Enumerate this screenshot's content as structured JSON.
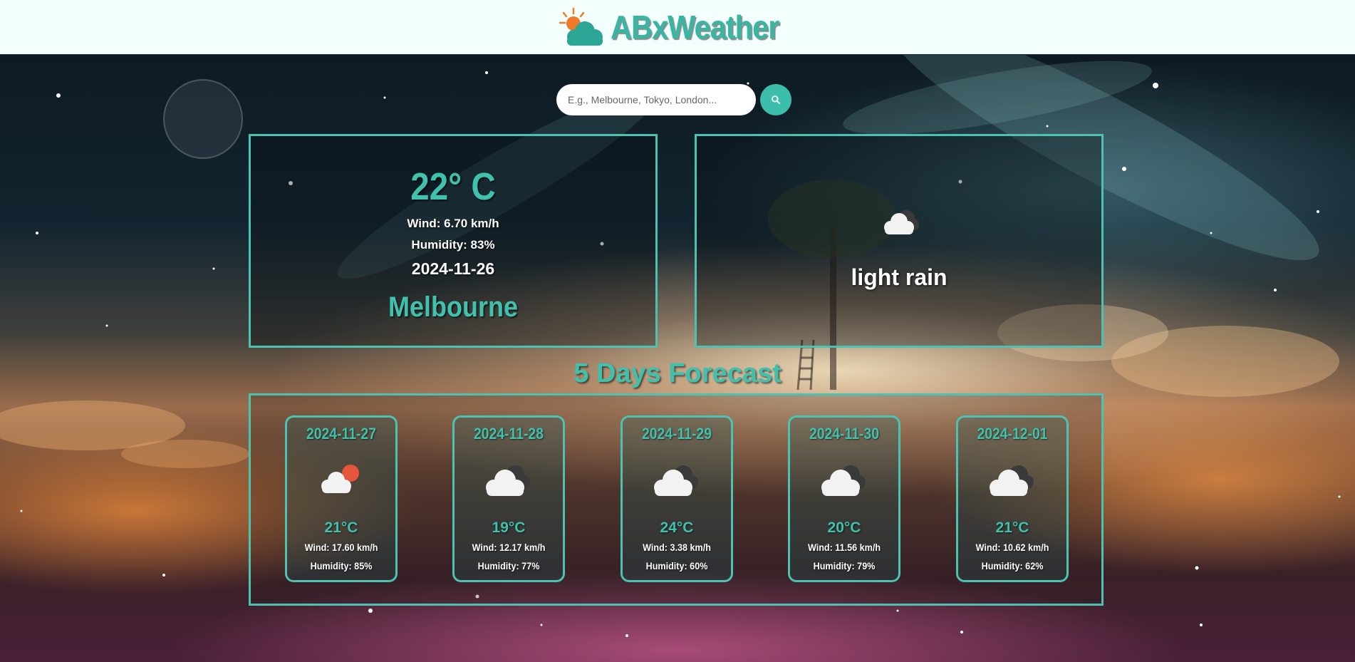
{
  "header": {
    "brand_name": "ABxWeather",
    "logo_icon": "sun-cloud-logo-icon"
  },
  "search": {
    "placeholder": "E.g., Melbourne, Tokyo, London...",
    "value": "",
    "button_icon": "search-icon"
  },
  "current": {
    "temperature": "22° C",
    "wind": "Wind: 6.70 km/h",
    "humidity": "Humidity: 83%",
    "date": "2024-11-26",
    "city": "Melbourne",
    "condition": "light rain",
    "condition_icon": "rain-cloud-icon"
  },
  "forecast": {
    "title": "5 Days Forecast",
    "days": [
      {
        "date": "2024-11-27",
        "temp": "21°C",
        "wind": "Wind: 17.60 km/h",
        "humidity": "Humidity: 85%",
        "icon": "partly-cloudy-icon"
      },
      {
        "date": "2024-11-28",
        "temp": "19°C",
        "wind": "Wind: 12.17 km/h",
        "humidity": "Humidity: 77%",
        "icon": "cloudy-icon"
      },
      {
        "date": "2024-11-29",
        "temp": "24°C",
        "wind": "Wind: 3.38 km/h",
        "humidity": "Humidity: 60%",
        "icon": "cloudy-icon"
      },
      {
        "date": "2024-11-30",
        "temp": "20°C",
        "wind": "Wind: 11.56 km/h",
        "humidity": "Humidity: 79%",
        "icon": "cloudy-icon"
      },
      {
        "date": "2024-12-01",
        "temp": "21°C",
        "wind": "Wind: 10.62 km/h",
        "humidity": "Humidity: 62%",
        "icon": "cloudy-icon"
      }
    ]
  },
  "colors": {
    "accent": "#3fc1ae",
    "panel_border": "#4ec2b2",
    "header_bg": "#f3fffd"
  }
}
